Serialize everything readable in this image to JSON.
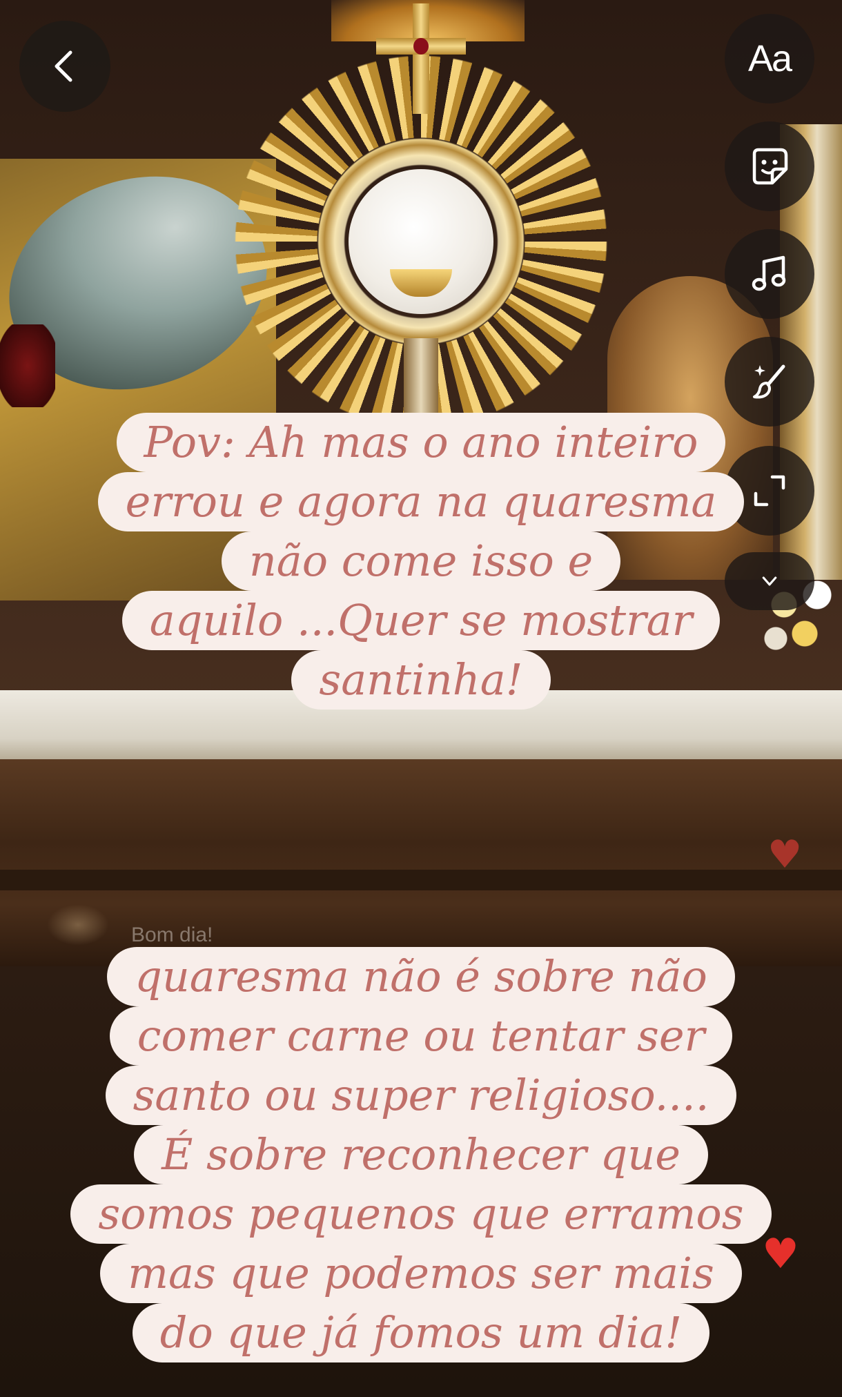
{
  "toolbar": {
    "back_icon": "chevron-left-icon",
    "text_tool_label": "Aa",
    "text_tool_icon": "text-icon",
    "sticker_icon": "sticker-icon",
    "music_icon": "music-note-icon",
    "draw_icon": "sparkle-brush-icon",
    "resize_icon": "expand-icon",
    "more_icon": "chevron-down-icon"
  },
  "background": {
    "comment_text": "Bom dia!"
  },
  "captions": {
    "top": [
      "Pov: Ah mas o ano inteiro",
      "errou e agora na quaresma",
      "não come isso e",
      "aquilo ...Quer se mostrar",
      "santinha!"
    ],
    "bottom": [
      "quaresma não é sobre não",
      "comer carne ou tentar ser",
      "santo ou super religioso....",
      "É sobre reconhecer que",
      "somos pequenos que erramos",
      "mas que podemos ser mais",
      "do que já fomos um dia!"
    ]
  },
  "colors": {
    "caption_bg": "#f8eeea",
    "caption_text": "#c0706a",
    "tool_bg": "#1e1916",
    "heart": "#e6302b"
  }
}
